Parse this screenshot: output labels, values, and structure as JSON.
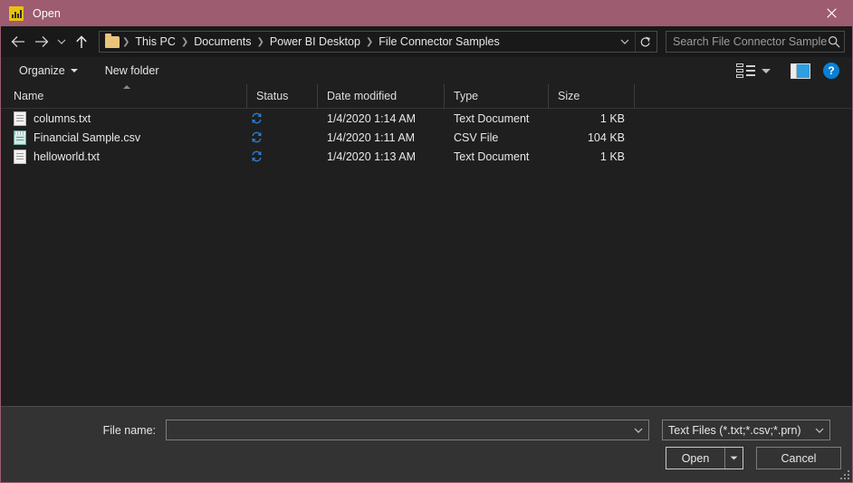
{
  "window": {
    "title": "Open",
    "app_icon": "powerbi-icon",
    "close_label": "×",
    "titlebar_color": "#9d5c70"
  },
  "nav": {
    "back_icon": "arrow-left-icon",
    "forward_icon": "arrow-right-icon",
    "recent_icon": "chevron-down-icon",
    "up_icon": "arrow-up-icon",
    "breadcrumbs": [
      "This PC",
      "Documents",
      "Power BI Desktop",
      "File Connector Samples"
    ],
    "address_dropdown_icon": "chevron-down-icon",
    "refresh_icon": "refresh-icon"
  },
  "search": {
    "placeholder": "Search File Connector Samples",
    "value": "",
    "icon": "search-icon"
  },
  "toolbar": {
    "organize_label": "Organize",
    "new_folder_label": "New folder",
    "view_icon": "view-options-icon",
    "preview_pane_icon": "preview-pane-icon",
    "help_icon": "help-icon",
    "help_glyph": "?"
  },
  "columns": [
    {
      "label": "Name",
      "sorted": "asc"
    },
    {
      "label": "Status",
      "sorted": ""
    },
    {
      "label": "Date modified",
      "sorted": ""
    },
    {
      "label": "Type",
      "sorted": ""
    },
    {
      "label": "Size",
      "sorted": ""
    }
  ],
  "files": [
    {
      "name": "columns.txt",
      "icon": "text-document-icon",
      "status_icon": "sync-pending-icon",
      "date_modified": "1/4/2020 1:14 AM",
      "type": "Text Document",
      "size": "1 KB"
    },
    {
      "name": "Financial Sample.csv",
      "icon": "csv-file-icon",
      "status_icon": "sync-pending-icon",
      "date_modified": "1/4/2020 1:11 AM",
      "type": "CSV File",
      "size": "104 KB"
    },
    {
      "name": "helloworld.txt",
      "icon": "text-document-icon",
      "status_icon": "sync-pending-icon",
      "date_modified": "1/4/2020 1:13 AM",
      "type": "Text Document",
      "size": "1 KB"
    }
  ],
  "footer": {
    "file_name_label": "File name:",
    "file_name_value": "",
    "file_name_placeholder": "",
    "file_type_filter": "Text Files (*.txt;*.csv;*.prn)",
    "open_label": "Open",
    "open_dropdown_icon": "chevron-down-icon",
    "cancel_label": "Cancel",
    "resize_grip": "resize-grip-icon"
  },
  "colors": {
    "accent": "#9d5c70",
    "sync_blue": "#2a7fd4",
    "help_blue": "#0a7fd4",
    "list_bg": "#1f1f1f",
    "footer_bg": "#333333"
  }
}
